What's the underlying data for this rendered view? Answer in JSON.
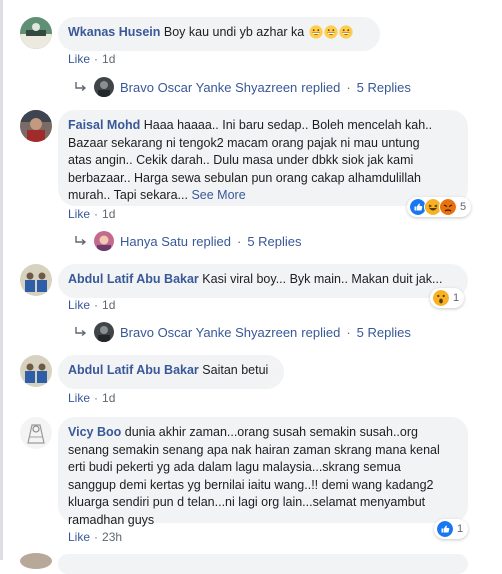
{
  "comments": [
    {
      "name": "Wkanas Husein",
      "text": "Boy kau undi yb azhar ka",
      "emoji_icon": "grinning-face-emoji",
      "emoji_count": 3,
      "like_label": "Like",
      "time": "1d",
      "reply_author": "Bravo Oscar Yanke Shyazreen",
      "replied_label": "replied",
      "replies_label": "5 Replies"
    },
    {
      "name": "Faisal Mohd",
      "text_lines": [
        "Haaa haaaa.. Ini baru sedap.. Boleh mencelah kah..",
        "Bazaar sekarang ni tengok2 macam orang pajak ni mau untung",
        "atas angin.. Cekik darah.. Dulu masa under dbkk siok jak kami",
        "berbazaar.. Harga sewa sebulan pun orang cakap alhamdulillah",
        "murah.. Tapi sekara..."
      ],
      "see_more": "See More",
      "like_label": "Like",
      "time": "1d",
      "reactions": {
        "icons": [
          "like-reaction-icon",
          "haha-reaction-icon",
          "angry-reaction-icon"
        ],
        "count": "5"
      },
      "reply_author": "Hanya Satu",
      "replied_label": "replied",
      "replies_label": "5 Replies"
    },
    {
      "name": "Abdul Latif Abu Bakar",
      "text": "Kasi viral boy... Byk main.. Makan duit jak...",
      "like_label": "Like",
      "time": "1d",
      "reactions": {
        "icons": [
          "wow-reaction-icon"
        ],
        "count": "1"
      },
      "reply_author": "Bravo Oscar Yanke Shyazreen",
      "replied_label": "replied",
      "replies_label": "5 Replies"
    },
    {
      "name": "Abdul Latif Abu Bakar",
      "text": "Saitan betui",
      "like_label": "Like",
      "time": "1d"
    },
    {
      "name": "Vicy Boo",
      "text_lines": [
        "dunia akhir zaman...orang susah semakin susah..org",
        "senang semakin senang apa nak hairan zaman skrang mana kenal",
        "erti budi pekerti yg ada dalam lagu malaysia...skrang semua",
        "sanggup demi kertas yg bernilai iaitu wang..!! demi wang kadang2",
        "kluarga sendiri pun d telan...ni lagi org lain...selamat menyambut",
        "ramadhan guys"
      ],
      "like_label": "Like",
      "time": "23h",
      "reactions": {
        "icons": [
          "like-reaction-icon"
        ],
        "count": "1"
      }
    }
  ],
  "colors": {
    "name": "#385898",
    "bubble": "#f2f3f5",
    "meta": "#606770",
    "text": "#1c1e21"
  }
}
